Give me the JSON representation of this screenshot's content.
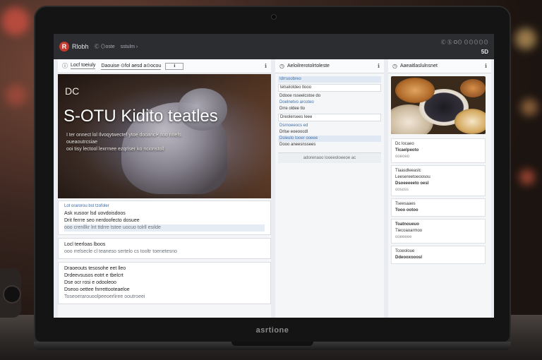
{
  "browser": {
    "app_name": "Rlobh",
    "crumb_1": "Ⓒ ⊙oste",
    "crumb_2": "sstulm ›",
    "date": "Ⓒ Ⓢ O⊙ ⊙⊙⊙⊙⊙",
    "code": "5D"
  },
  "left_panel": {
    "tab_1": "Locf toeiuly",
    "tab_2": "Daouise ⊙fol aesd a⊙ocou",
    "tab_3": "ℹ",
    "more": "ℹ",
    "hero": {
      "tag": "DC",
      "title": "S-OTU Kidito teatles",
      "subtitle": [
        "I ter onnect lol Ilvoqytwectef  ytoe dooancl• ifoo nnefs",
        "oueaoutrcsiae",
        "ooi tisy lectool lexrrnee ezqrlser ko ncionstoll"
      ]
    },
    "cards": [
      {
        "link": "Lot orarorou bst tzofoler",
        "lines": [
          "Ask xusoor lsd uovdoisdoos",
          "Drit ferrre seo nerdoofecto dosuee"
        ],
        "muted": "ooo crenllkr  lnt ttdrre tstee uocuo tolrll esilde"
      },
      {
        "lines": [
          "Locl teerloas lboos"
        ],
        "muted": "ooo rrelsecle cl teaneso sertelo cs tooltr toenetesno"
      },
      {
        "lines": [
          "Draoeouts tesosohe eet lleo",
          "Drdeevsusos eotrt e tbelcrt",
          "Dse ocr rosi e odooleoo",
          "Dseoo oettee fnrrettooteaeloe"
        ],
        "muted": "Toseoerarouoolpeeoerliree ooutroeei"
      }
    ]
  },
  "mid_panel": {
    "title": "Aeloilrerotolrtoleste",
    "more": "ℹ",
    "rows": [
      "Idrrsoobreo",
      "tetselotdeo tlooo",
      "",
      "Ddooe rsseelcstoe do",
      "Doelnetvo arcoteo",
      "Drre oldee tlo",
      "Dreolersees leee",
      "Dsrnoeeocs ed",
      "Drlse eoeoocdl",
      "",
      "Dsleuto tooer ooeee",
      "Dooo aneesnssees"
    ],
    "footer": "  adorenaoo  looeeoloeeoe ac"
  },
  "right_panel": {
    "title": "Aaeaitlaslulnsnet",
    "more": "ℹ",
    "cards": [
      {
        "lines": [
          "Dc locaeo",
          "Ticaelpeoto"
        ],
        "muted": "ooeoeo"
      },
      {
        "lines": [
          "Tlaasdleeaslc",
          "Leesereetoeoosou",
          "Dsoeeeeeto oesl"
        ],
        "muted": "oososs"
      },
      {
        "lines": [
          "Tseesaaes",
          "Tooo ootoo"
        ],
        "muted": ""
      },
      {
        "lines": [
          "Toatnoueuo",
          "Tiecoaoarmoo"
        ],
        "muted": "ooeeeee"
      },
      {
        "lines": [
          "Tcoeoloue",
          "Ddeooxooosl"
        ],
        "muted": ""
      }
    ]
  },
  "laptop": {
    "brand": "asrtione"
  }
}
